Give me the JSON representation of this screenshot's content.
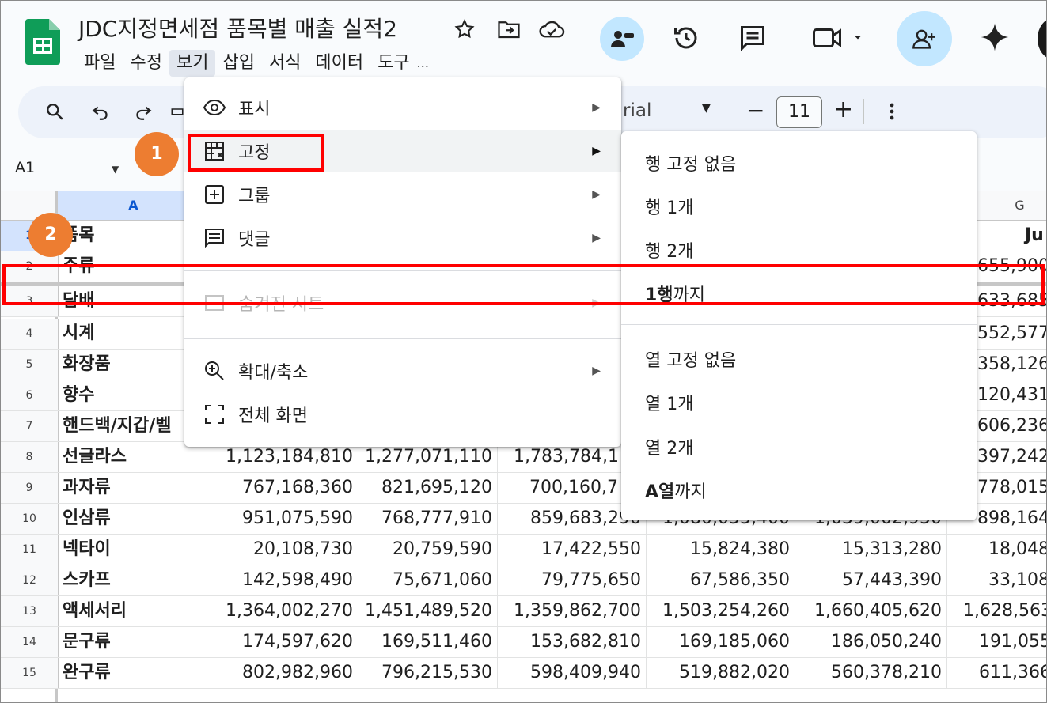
{
  "doc": {
    "title": "JDC지정면세점 품목별 매출 실적2"
  },
  "menubar": [
    "파일",
    "수정",
    "보기",
    "삽입",
    "서식",
    "데이터",
    "도구",
    "..."
  ],
  "toolbar": {
    "font": "rial",
    "font_size": "11",
    "minus": "−",
    "plus": "+"
  },
  "formula": {
    "cell_ref": "A1"
  },
  "columns": {
    "a": "A",
    "g": "G"
  },
  "rows": [
    {
      "n": "1",
      "a": "품목",
      "g": "Ju"
    },
    {
      "n": "2",
      "a": "주류",
      "g": "655,900"
    },
    {
      "n": "3",
      "a": "담배",
      "g": "633,685"
    },
    {
      "n": "4",
      "a": "시계",
      "g": "552,577"
    },
    {
      "n": "5",
      "a": "화장품",
      "g": "358,126"
    },
    {
      "n": "6",
      "a": "향수",
      "g": "120,431"
    },
    {
      "n": "7",
      "a": "핸드백/지갑/벨",
      "g": "606,236"
    },
    {
      "n": "8",
      "a": "선글라스",
      "b": "1,123,184,810",
      "c": "1,277,071,110",
      "d": "1,783,784,1",
      "g": "397,242"
    },
    {
      "n": "9",
      "a": "과자류",
      "b": "767,168,360",
      "c": "821,695,120",
      "d": "700,160,7",
      "g": "778,015"
    },
    {
      "n": "10",
      "a": "인삼류",
      "b": "951,075,590",
      "c": "768,777,910",
      "d": "859,683,290",
      "e": "1,080,055,400",
      "f": "1,039,002,950",
      "g": "898,164"
    },
    {
      "n": "11",
      "a": "넥타이",
      "b": "20,108,730",
      "c": "20,759,590",
      "d": "17,422,550",
      "e": "15,824,380",
      "f": "15,313,280",
      "g": "18,048"
    },
    {
      "n": "12",
      "a": "스카프",
      "b": "142,598,490",
      "c": "75,671,060",
      "d": "79,775,650",
      "e": "67,586,350",
      "f": "57,443,390",
      "g": "33,108"
    },
    {
      "n": "13",
      "a": "액세서리",
      "b": "1,364,002,270",
      "c": "1,451,489,520",
      "d": "1,359,862,700",
      "e": "1,503,254,260",
      "f": "1,660,405,620",
      "g": "1,628,563"
    },
    {
      "n": "14",
      "a": "문구류",
      "b": "174,597,620",
      "c": "169,511,460",
      "d": "153,682,810",
      "e": "169,185,060",
      "f": "186,050,240",
      "g": "191,055"
    },
    {
      "n": "15",
      "a": "완구류",
      "b": "802,982,960",
      "c": "796,215,530",
      "d": "598,409,940",
      "e": "519,882,020",
      "f": "560,378,210",
      "g": "611,366"
    }
  ],
  "view_menu": {
    "show": "표시",
    "freeze": "고정",
    "group": "그룹",
    "comments": "댓글",
    "hidden_sheets": "숨겨진 시트",
    "zoom": "확대/축소",
    "fullscreen": "전체 화면"
  },
  "freeze_submenu": {
    "no_rows": "행 고정 없음",
    "one_row": "행 1개",
    "two_rows": "행 2개",
    "up_to_row_bold": "1행",
    "up_to_row_rest": "까지",
    "no_cols": "열 고정 없음",
    "one_col": "열 1개",
    "two_cols": "열 2개",
    "up_to_col_bold": "A열",
    "up_to_col_rest": "까지"
  },
  "callouts": [
    "1",
    "2"
  ],
  "colors": {
    "callout": "#ed7d31",
    "highlight": "#ff0000",
    "sheets_green": "#0f9d58"
  }
}
